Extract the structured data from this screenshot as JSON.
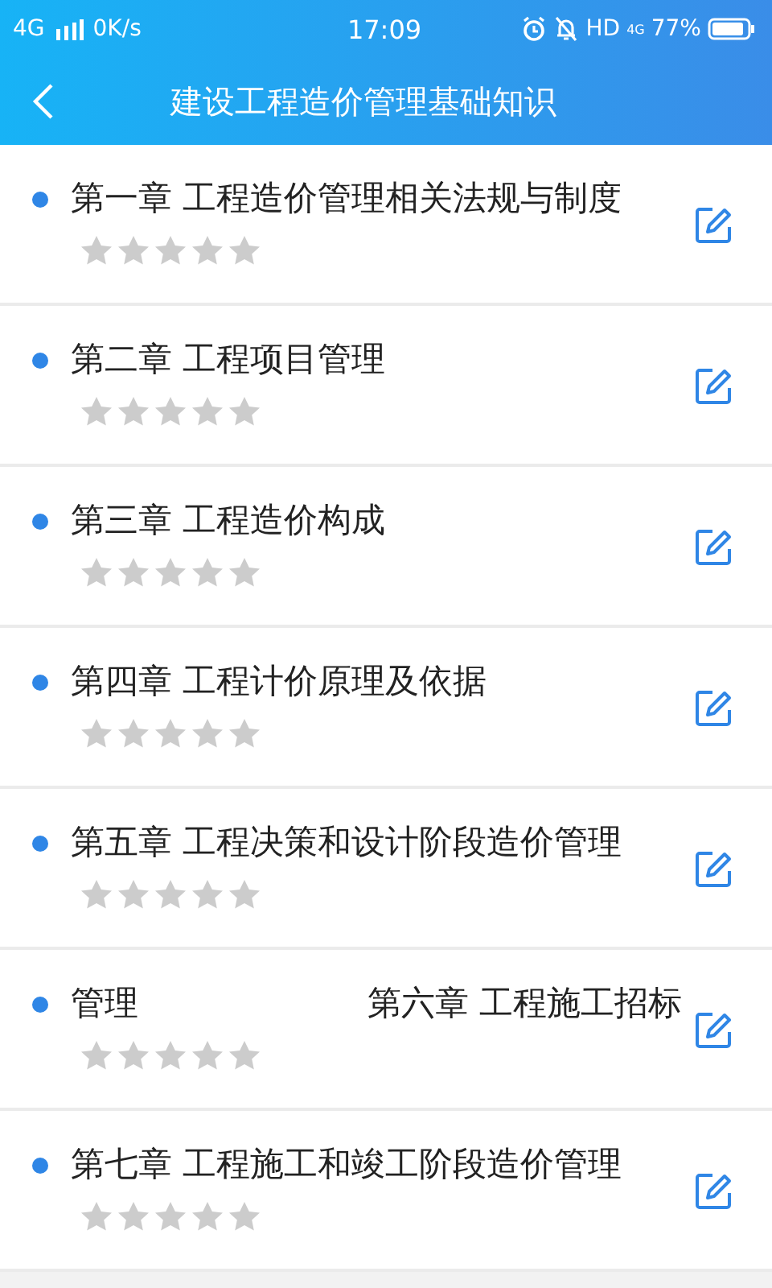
{
  "status_bar": {
    "network": "4G",
    "speed": "0K/s",
    "time": "17:09",
    "hd": "HD",
    "network_small": "4G",
    "battery": "77%"
  },
  "header": {
    "title": "建设工程造价管理基础知识"
  },
  "chapters": [
    {
      "kind": "plain",
      "title": "第一章 工程造价管理相关法规与制度",
      "stars": 0
    },
    {
      "kind": "plain",
      "title": "第二章 工程项目管理",
      "stars": 0
    },
    {
      "kind": "plain",
      "title": "第三章 工程造价构成",
      "stars": 0
    },
    {
      "kind": "plain",
      "title": "第四章 工程计价原理及依据",
      "stars": 0
    },
    {
      "kind": "plain",
      "title": "第五章 工程决策和设计阶段造价管理",
      "stars": 0
    },
    {
      "kind": "marquee",
      "parts": [
        "管理",
        "第六章 工程施工招标"
      ],
      "stars": 0
    },
    {
      "kind": "plain",
      "title": "第七章 工程施工和竣工阶段造价管理",
      "stars": 0
    }
  ]
}
